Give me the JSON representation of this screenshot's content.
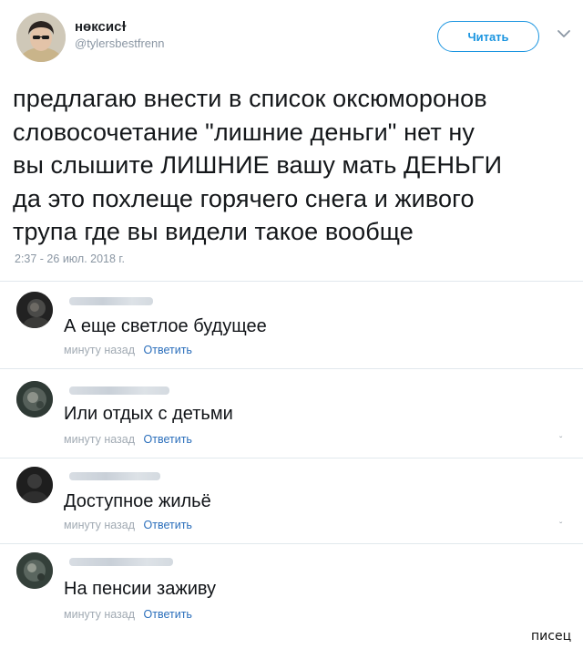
{
  "tweet": {
    "author": {
      "display_name": "нөксисɫ",
      "handle": "@tylersbestfrenn",
      "avatar_icon": "user-avatar-photo"
    },
    "follow_label": "Читать",
    "menu_icon": "chevron-down-icon",
    "text": "предлагаю внести в список оксюморонов\nсловосочетание \"лишние деньги\" нет ну\nвы слышите ЛИШНИЕ вашу мать ДЕНЬГИ\nда это похлеще горячего снега и живого\nтрупа где вы видели такое вообще",
    "timestamp": "2:37 - 26 июл. 2018 г."
  },
  "replies": [
    {
      "text": "А еще светлое будущее",
      "time": "минуту назад",
      "action": "Ответить",
      "avatar_icon": "user-avatar-photo"
    },
    {
      "text": "Или отдых с детьми",
      "time": "минуту назад",
      "action": "Ответить",
      "avatar_icon": "user-avatar-photo"
    },
    {
      "text": "Доступное жильё",
      "time": "минуту назад",
      "action": "Ответить",
      "avatar_icon": "user-avatar-photo"
    },
    {
      "text": "На пенсии заживу",
      "time": "минуту назад",
      "action": "Ответить",
      "avatar_icon": "user-avatar-photo"
    }
  ],
  "watermark": "писец",
  "colors": {
    "accent": "#1b95e0",
    "reply_action": "#2a6ebb",
    "muted": "#8a96a3",
    "divider": "#e1e8ed"
  }
}
